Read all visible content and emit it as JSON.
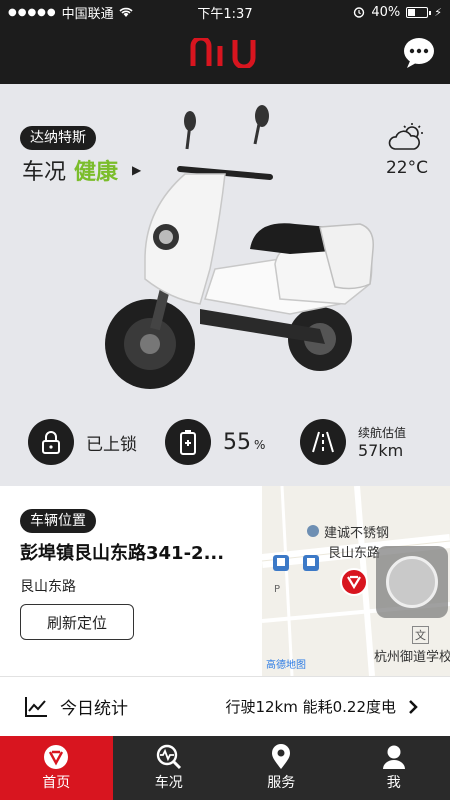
{
  "status_bar": {
    "carrier": "中国联通",
    "time": "下午1:37",
    "battery": "40%"
  },
  "header": {
    "logo_text": "niu",
    "brand_color": "#d8151f"
  },
  "vehicle": {
    "name": "达纳特斯",
    "condition_label": "车况",
    "condition_value": "健康",
    "condition_color": "#7bbd2b"
  },
  "weather": {
    "icon": "partly-cloudy-icon",
    "temperature": "22°C"
  },
  "stats": {
    "lock_status": "已上锁",
    "battery_value": "55",
    "battery_unit": "%",
    "range_label": "续航估值",
    "range_value": "57km"
  },
  "location": {
    "badge": "车辆位置",
    "address": "彭埠镇艮山东路341-2...",
    "street": "艮山东路",
    "refresh_label": "刷新定位",
    "map_labels": {
      "poi_1": "建诚不锈钢",
      "road": "艮山东路",
      "poi_2": "杭州御道学校",
      "watermark": "高德地图"
    }
  },
  "today": {
    "title": "今日统计",
    "info": "行驶12km  能耗0.22度电"
  },
  "tabs": [
    {
      "label": "首页",
      "icon": "home-icon"
    },
    {
      "label": "车况",
      "icon": "vehicle-status-icon"
    },
    {
      "label": "服务",
      "icon": "location-pin-icon"
    },
    {
      "label": "我",
      "icon": "user-icon"
    }
  ]
}
